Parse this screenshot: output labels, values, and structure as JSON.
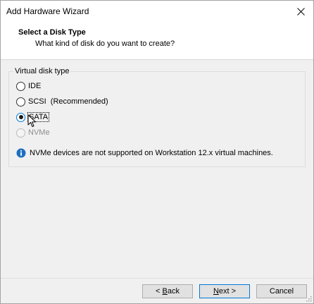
{
  "window": {
    "title": "Add Hardware Wizard"
  },
  "header": {
    "title": "Select a Disk Type",
    "subtitle": "What kind of disk do you want to create?"
  },
  "disk_type_group": {
    "label": "Virtual disk type",
    "options": [
      {
        "label": "IDE",
        "checked": false,
        "enabled": true
      },
      {
        "label": "SCSI  (Recommended)",
        "checked": false,
        "enabled": true
      },
      {
        "label": "SATA",
        "checked": true,
        "enabled": true
      },
      {
        "label": "NVMe",
        "checked": false,
        "enabled": false
      }
    ],
    "info_text": "NVMe devices are not supported on Workstation 12.x virtual machines."
  },
  "buttons": {
    "back_prefix": "< ",
    "back_mnemonic": "B",
    "back_rest": "ack",
    "next_mnemonic": "N",
    "next_rest": "ext >",
    "cancel": "Cancel"
  },
  "colors": {
    "accent": "#0078d7",
    "info_icon": "#1c6fc1"
  },
  "icons": {
    "close": "close-icon",
    "info": "info-icon",
    "cursor": "mouse-pointer-icon",
    "grip": "resize-grip-icon"
  }
}
